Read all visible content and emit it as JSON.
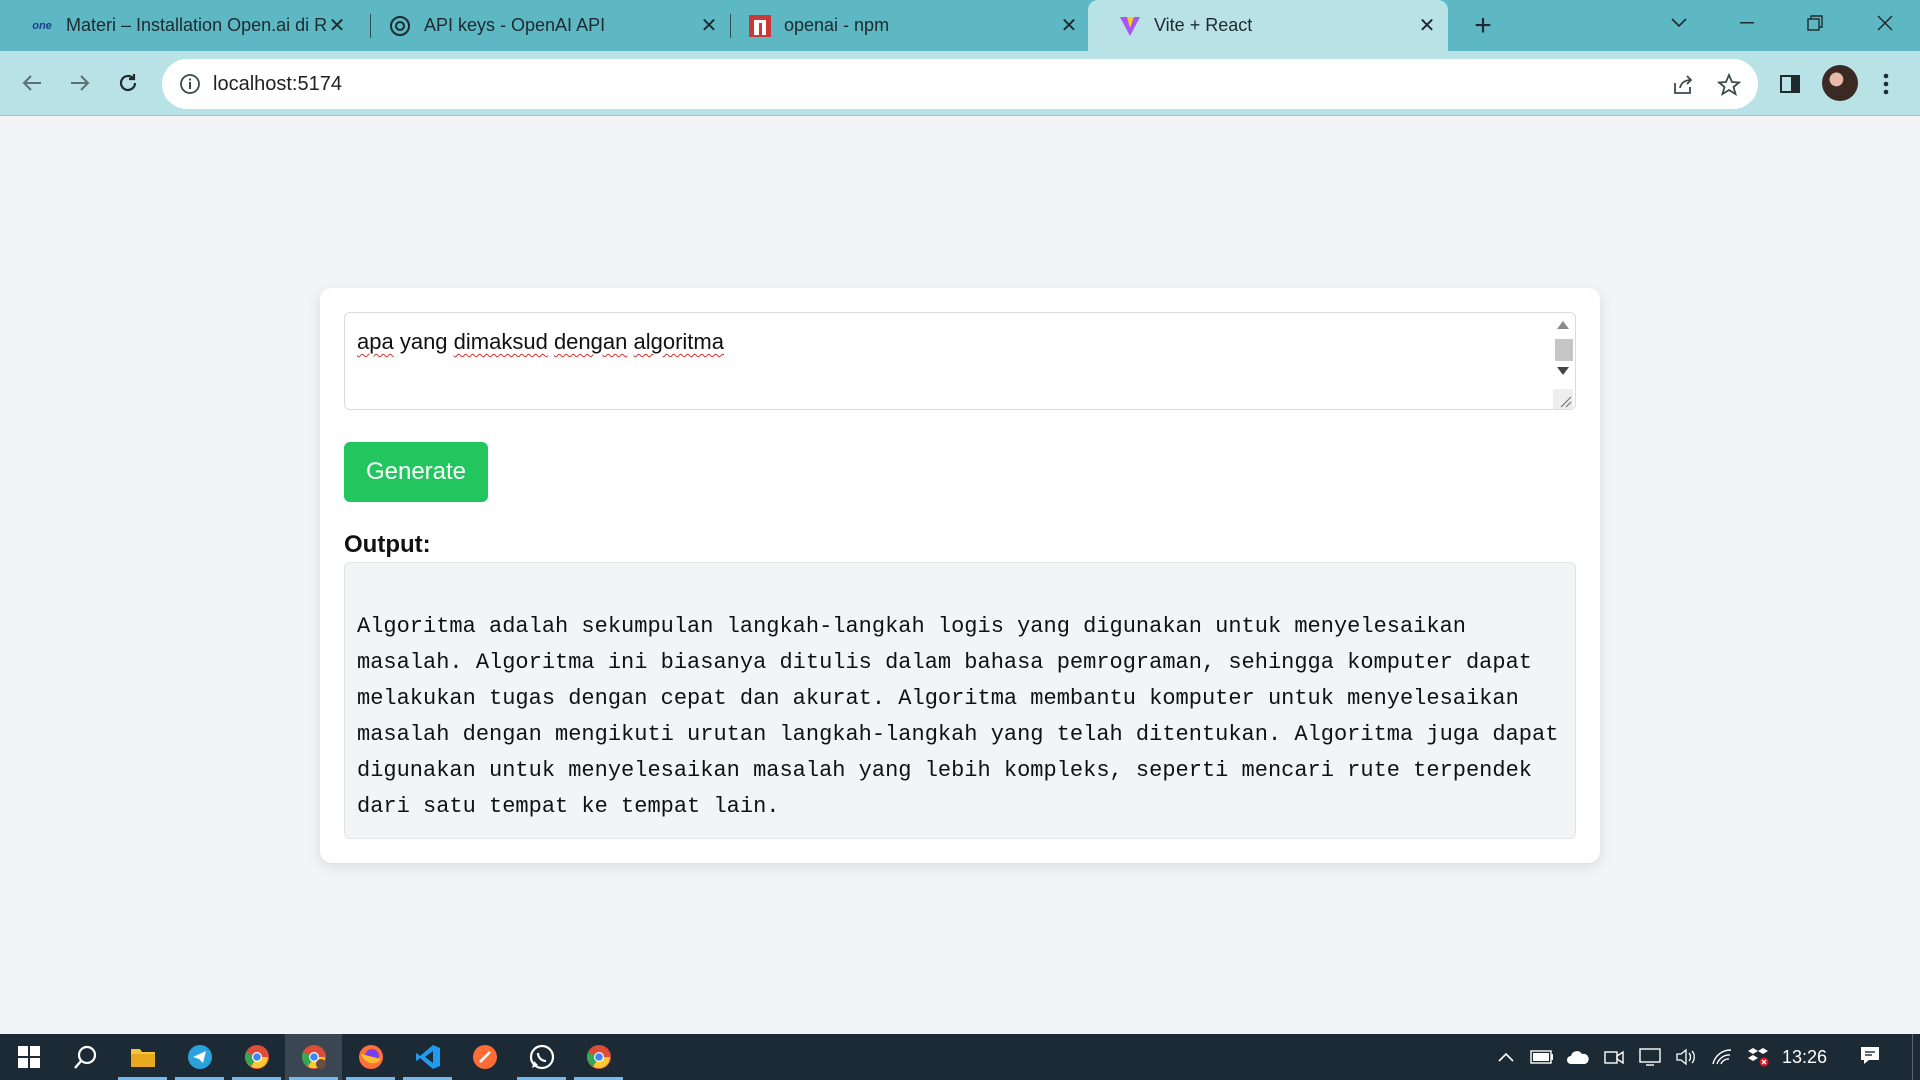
{
  "browser": {
    "tabs": [
      {
        "title": "Materi – Installation Open.ai di R",
        "favicon": "one-logo-icon"
      },
      {
        "title": "API keys - OpenAI API",
        "favicon": "openai-logo-icon"
      },
      {
        "title": "openai - npm",
        "favicon": "npm-logo-icon"
      },
      {
        "title": "Vite + React",
        "favicon": "vite-logo-icon",
        "active": true
      }
    ],
    "favicon_labels": {
      "one": "one"
    },
    "address": "localhost:5174"
  },
  "app": {
    "prompt_value": [
      "apa",
      " yang ",
      "dimaksud",
      " ",
      "dengan",
      " ",
      "algoritma"
    ],
    "generate_label": "Generate",
    "output_label": "Output:",
    "output_text": "Algoritma adalah sekumpulan langkah-langkah logis yang digunakan untuk menyelesaikan masalah. Algoritma ini biasanya ditulis dalam bahasa pemrograman, sehingga komputer dapat melakukan tugas dengan cepat dan akurat. Algoritma membantu komputer untuk menyelesaikan masalah dengan mengikuti urutan langkah-langkah yang telah ditentukan. Algoritma juga dapat digunakan untuk menyelesaikan masalah yang lebih kompleks, seperti mencari rute terpendek dari satu tempat ke tempat lain.",
    "accent_color": "#22c55e"
  },
  "taskbar": {
    "apps": [
      "start-icon",
      "search-icon",
      "file-explorer-icon",
      "telegram-icon",
      "chrome-icon",
      "chrome-profile-icon",
      "firefox-icon",
      "vscode-icon",
      "postman-icon",
      "whatsapp-icon",
      "chrome-icon"
    ],
    "clock": "13:26"
  }
}
